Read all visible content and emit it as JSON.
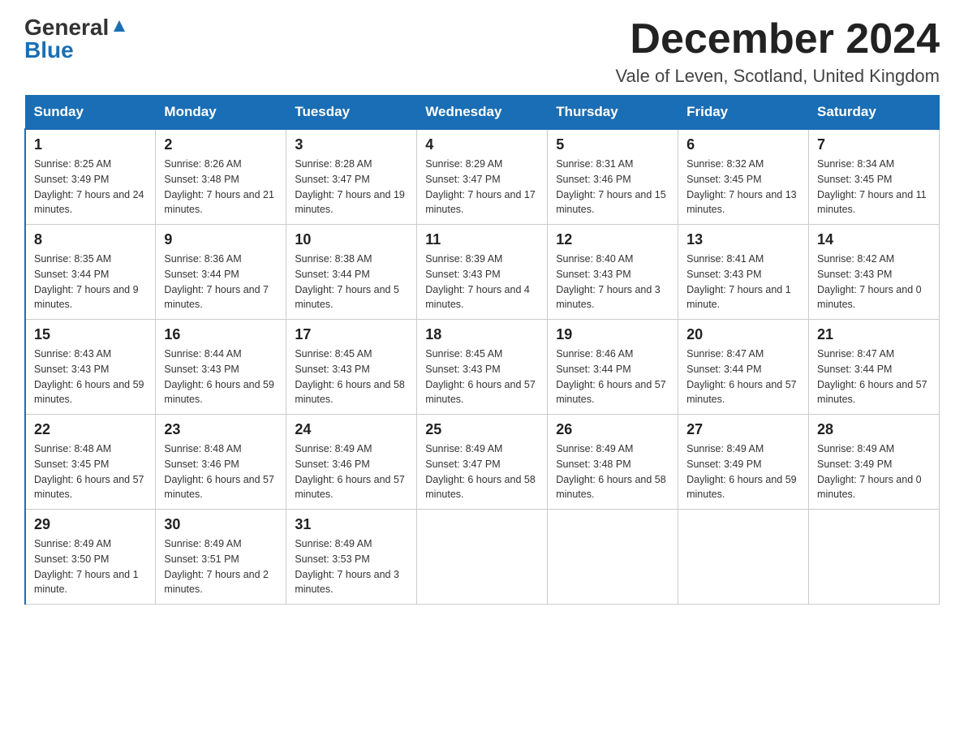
{
  "header": {
    "logo": {
      "general": "General",
      "blue": "Blue"
    },
    "title": "December 2024",
    "location": "Vale of Leven, Scotland, United Kingdom"
  },
  "weekdays": [
    "Sunday",
    "Monday",
    "Tuesday",
    "Wednesday",
    "Thursday",
    "Friday",
    "Saturday"
  ],
  "weeks": [
    [
      {
        "day": "1",
        "sunrise": "8:25 AM",
        "sunset": "3:49 PM",
        "daylight": "7 hours and 24 minutes."
      },
      {
        "day": "2",
        "sunrise": "8:26 AM",
        "sunset": "3:48 PM",
        "daylight": "7 hours and 21 minutes."
      },
      {
        "day": "3",
        "sunrise": "8:28 AM",
        "sunset": "3:47 PM",
        "daylight": "7 hours and 19 minutes."
      },
      {
        "day": "4",
        "sunrise": "8:29 AM",
        "sunset": "3:47 PM",
        "daylight": "7 hours and 17 minutes."
      },
      {
        "day": "5",
        "sunrise": "8:31 AM",
        "sunset": "3:46 PM",
        "daylight": "7 hours and 15 minutes."
      },
      {
        "day": "6",
        "sunrise": "8:32 AM",
        "sunset": "3:45 PM",
        "daylight": "7 hours and 13 minutes."
      },
      {
        "day": "7",
        "sunrise": "8:34 AM",
        "sunset": "3:45 PM",
        "daylight": "7 hours and 11 minutes."
      }
    ],
    [
      {
        "day": "8",
        "sunrise": "8:35 AM",
        "sunset": "3:44 PM",
        "daylight": "7 hours and 9 minutes."
      },
      {
        "day": "9",
        "sunrise": "8:36 AM",
        "sunset": "3:44 PM",
        "daylight": "7 hours and 7 minutes."
      },
      {
        "day": "10",
        "sunrise": "8:38 AM",
        "sunset": "3:44 PM",
        "daylight": "7 hours and 5 minutes."
      },
      {
        "day": "11",
        "sunrise": "8:39 AM",
        "sunset": "3:43 PM",
        "daylight": "7 hours and 4 minutes."
      },
      {
        "day": "12",
        "sunrise": "8:40 AM",
        "sunset": "3:43 PM",
        "daylight": "7 hours and 3 minutes."
      },
      {
        "day": "13",
        "sunrise": "8:41 AM",
        "sunset": "3:43 PM",
        "daylight": "7 hours and 1 minute."
      },
      {
        "day": "14",
        "sunrise": "8:42 AM",
        "sunset": "3:43 PM",
        "daylight": "7 hours and 0 minutes."
      }
    ],
    [
      {
        "day": "15",
        "sunrise": "8:43 AM",
        "sunset": "3:43 PM",
        "daylight": "6 hours and 59 minutes."
      },
      {
        "day": "16",
        "sunrise": "8:44 AM",
        "sunset": "3:43 PM",
        "daylight": "6 hours and 59 minutes."
      },
      {
        "day": "17",
        "sunrise": "8:45 AM",
        "sunset": "3:43 PM",
        "daylight": "6 hours and 58 minutes."
      },
      {
        "day": "18",
        "sunrise": "8:45 AM",
        "sunset": "3:43 PM",
        "daylight": "6 hours and 57 minutes."
      },
      {
        "day": "19",
        "sunrise": "8:46 AM",
        "sunset": "3:44 PM",
        "daylight": "6 hours and 57 minutes."
      },
      {
        "day": "20",
        "sunrise": "8:47 AM",
        "sunset": "3:44 PM",
        "daylight": "6 hours and 57 minutes."
      },
      {
        "day": "21",
        "sunrise": "8:47 AM",
        "sunset": "3:44 PM",
        "daylight": "6 hours and 57 minutes."
      }
    ],
    [
      {
        "day": "22",
        "sunrise": "8:48 AM",
        "sunset": "3:45 PM",
        "daylight": "6 hours and 57 minutes."
      },
      {
        "day": "23",
        "sunrise": "8:48 AM",
        "sunset": "3:46 PM",
        "daylight": "6 hours and 57 minutes."
      },
      {
        "day": "24",
        "sunrise": "8:49 AM",
        "sunset": "3:46 PM",
        "daylight": "6 hours and 57 minutes."
      },
      {
        "day": "25",
        "sunrise": "8:49 AM",
        "sunset": "3:47 PM",
        "daylight": "6 hours and 58 minutes."
      },
      {
        "day": "26",
        "sunrise": "8:49 AM",
        "sunset": "3:48 PM",
        "daylight": "6 hours and 58 minutes."
      },
      {
        "day": "27",
        "sunrise": "8:49 AM",
        "sunset": "3:49 PM",
        "daylight": "6 hours and 59 minutes."
      },
      {
        "day": "28",
        "sunrise": "8:49 AM",
        "sunset": "3:49 PM",
        "daylight": "7 hours and 0 minutes."
      }
    ],
    [
      {
        "day": "29",
        "sunrise": "8:49 AM",
        "sunset": "3:50 PM",
        "daylight": "7 hours and 1 minute."
      },
      {
        "day": "30",
        "sunrise": "8:49 AM",
        "sunset": "3:51 PM",
        "daylight": "7 hours and 2 minutes."
      },
      {
        "day": "31",
        "sunrise": "8:49 AM",
        "sunset": "3:53 PM",
        "daylight": "7 hours and 3 minutes."
      },
      null,
      null,
      null,
      null
    ]
  ]
}
